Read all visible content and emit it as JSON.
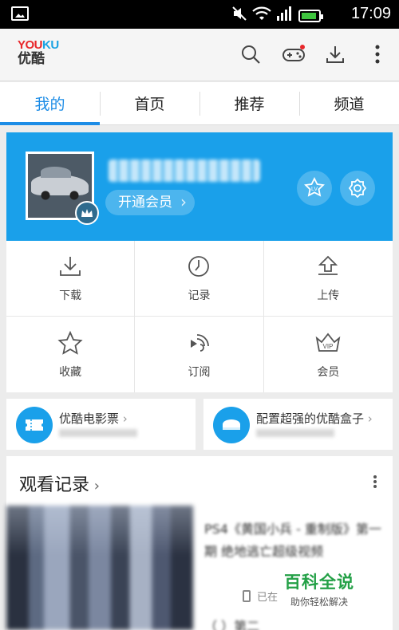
{
  "status_bar": {
    "time": "17:09",
    "icons": [
      "image-icon",
      "mute-icon",
      "wifi-icon",
      "signal-icon",
      "battery-icon"
    ]
  },
  "app": {
    "logo_en_red": "YOU",
    "logo_en_blue": "KU",
    "logo_cn": "优酷",
    "actions": [
      "search-icon",
      "game-controller-icon",
      "download-icon",
      "more-vertical-icon"
    ]
  },
  "tabs": [
    {
      "label": "我的",
      "active": true
    },
    {
      "label": "首页",
      "active": false
    },
    {
      "label": "推荐",
      "active": false
    },
    {
      "label": "频道",
      "active": false
    }
  ],
  "profile": {
    "vip_button": "开通会员",
    "level_icon": "LV",
    "colors": {
      "card_bg": "#1aa0ea",
      "accent": "#1c8ce6"
    }
  },
  "grid": [
    {
      "label": "下载",
      "icon": "download-icon"
    },
    {
      "label": "记录",
      "icon": "clock-icon"
    },
    {
      "label": "上传",
      "icon": "upload-icon"
    },
    {
      "label": "收藏",
      "icon": "star-icon"
    },
    {
      "label": "订阅",
      "icon": "rss-icon"
    },
    {
      "label": "会员",
      "icon": "vip-crown-icon"
    }
  ],
  "promos": [
    {
      "title": "优酷电影票",
      "icon": "ticket-icon"
    },
    {
      "title": "配置超强的优酷盒子",
      "icon": "tv-box-icon"
    }
  ],
  "history": {
    "heading": "观看记录",
    "item": {
      "title": "PS4《黄国小兵 - 重制版》第一期 绝地逃亡超级视频",
      "device_text": "已在",
      "title2": "（ ）第二"
    }
  },
  "watermark": {
    "big": "百科全说",
    "small": "助你轻松解决"
  }
}
